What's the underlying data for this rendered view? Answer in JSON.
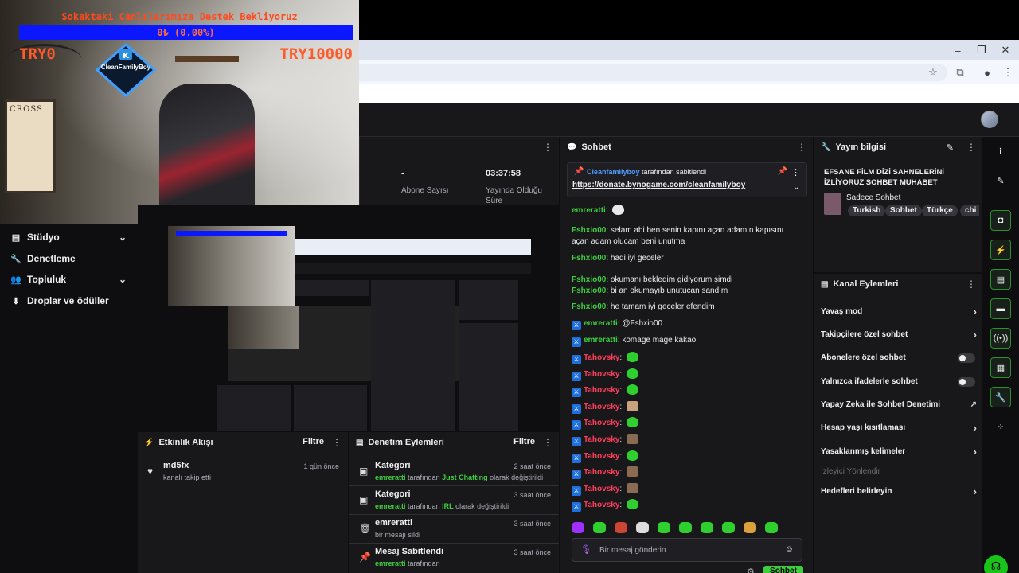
{
  "overlay": {
    "donation_title": "Sokaktaki Canlılarımıza Destek Bekliyoruz",
    "donation_progress": "0₺ (0.00%)",
    "donation_progress_fraction": 0.0,
    "donation_min": "TRY0",
    "donation_max": "TRY10000",
    "logo_text": "CleanFamilyBoy",
    "poster_text": "CROSS"
  },
  "nav": {
    "items": [
      {
        "label": "Stüdyo",
        "icon": "studio-icon",
        "has_chevron": true
      },
      {
        "label": "Denetleme",
        "icon": "wrench-icon",
        "has_chevron": false
      },
      {
        "label": "Topluluk",
        "icon": "community-icon",
        "has_chevron": true
      },
      {
        "label": "Droplar ve ödüller",
        "icon": "drops-icon",
        "has_chevron": false
      }
    ]
  },
  "stats": {
    "subs_value": "-",
    "subs_label": "Abone Sayısı",
    "uptime_value": "03:37:58",
    "uptime_label": "Yayında Olduğu Süre"
  },
  "activity": {
    "title": "Etkinlik Akışı",
    "filter_label": "Filtre",
    "items": [
      {
        "user": "md5fx",
        "desc": "kanalı takip etti",
        "time": "1 gün önce"
      }
    ]
  },
  "modlog": {
    "title": "Denetim Eylemleri",
    "filter_label": "Filtre",
    "items": [
      {
        "title": "Kategori",
        "user": "emreratti",
        "mid": "tarafından",
        "value": "Just Chatting",
        "tail": "olarak değiştirildi",
        "time": "2 saat önce"
      },
      {
        "title": "Kategori",
        "user": "emreratti",
        "mid": "tarafından",
        "value": "IRL",
        "tail": "olarak değiştirildi",
        "time": "3 saat önce"
      },
      {
        "title": "emreratti",
        "user": "",
        "mid": "bir mesajı sildi",
        "value": "",
        "tail": "",
        "time": "3 saat önce"
      },
      {
        "title": "Mesaj Sabitlendi",
        "user": "emreratti",
        "mid": "tarafından",
        "value": "",
        "tail": "",
        "time": "3 saat önce"
      }
    ]
  },
  "chat": {
    "title": "Sohbet",
    "pinned_by": "Cleanfamilyboy",
    "pinned_suffix": "tarafından sabitlendi",
    "pinned_link": "https://donate.bynogame.com/cleanfamilyboy",
    "messages": [
      {
        "user": "emreratti",
        "color": "#3ecf3e",
        "badge": false,
        "text": "",
        "emote": "white"
      },
      {
        "user": "Fshxio00",
        "color": "#3ecf3e",
        "badge": false,
        "text": "selam abi ben senin kapını açan adamın kapısını açan adam olucam beni unutma",
        "emote": ""
      },
      {
        "user": "Fshxio00",
        "color": "#3ecf3e",
        "badge": false,
        "text": "hadi iyi geceler",
        "emote": ""
      },
      {
        "user": "Fshxio00",
        "color": "#3ecf3e",
        "badge": false,
        "text": "okumanı bekledim gidiyorum şimdi",
        "emote": ""
      },
      {
        "user": "Fshxio00",
        "color": "#3ecf3e",
        "badge": false,
        "text": "bi an okumayıb unutucan sandım",
        "emote": ""
      },
      {
        "user": "Fshxio00",
        "color": "#3ecf3e",
        "badge": false,
        "text": "he tamam iyi geceler efendim",
        "emote": ""
      },
      {
        "user": "emreratti",
        "color": "#3ecf3e",
        "badge": true,
        "text": "@Fshxio00",
        "emote": ""
      },
      {
        "user": "emreratti",
        "color": "#3ecf3e",
        "badge": true,
        "text": "komage mage kakao",
        "emote": ""
      },
      {
        "user": "Tahovsky",
        "color": "#ff3e5a",
        "badge": true,
        "text": "",
        "emote": "green"
      },
      {
        "user": "Tahovsky",
        "color": "#ff3e5a",
        "badge": true,
        "text": "",
        "emote": "green"
      },
      {
        "user": "Tahovsky",
        "color": "#ff3e5a",
        "badge": true,
        "text": "",
        "emote": "green"
      },
      {
        "user": "Tahovsky",
        "color": "#ff3e5a",
        "badge": true,
        "text": "",
        "emote": "cat"
      },
      {
        "user": "Tahovsky",
        "color": "#ff3e5a",
        "badge": true,
        "text": "",
        "emote": "green"
      },
      {
        "user": "Tahovsky",
        "color": "#ff3e5a",
        "badge": true,
        "text": "",
        "emote": "brown"
      },
      {
        "user": "Tahovsky",
        "color": "#ff3e5a",
        "badge": true,
        "text": "",
        "emote": "green"
      },
      {
        "user": "Tahovsky",
        "color": "#ff3e5a",
        "badge": true,
        "text": "",
        "emote": "brown"
      },
      {
        "user": "Tahovsky",
        "color": "#ff3e5a",
        "badge": true,
        "text": "",
        "emote": "brown"
      },
      {
        "user": "Tahovsky",
        "color": "#ff3e5a",
        "badge": true,
        "text": "",
        "emote": "green"
      }
    ],
    "input_placeholder": "Bir mesaj gönderin",
    "send_label": "Sohbet"
  },
  "stream_info": {
    "panel_title": "Yayın bilgisi",
    "title": "EFSANE FİLM DİZİ SAHNELERİNİ İZLİYORUZ SOHBET MUHABET",
    "category": "Sadece Sohbet",
    "tags": [
      "Turkish",
      "Sohbet",
      "Türkçe",
      "chi"
    ]
  },
  "channel_actions": {
    "title": "Kanal Eylemleri",
    "items": [
      {
        "label": "Yavaş mod",
        "control": "chevron"
      },
      {
        "label": "Takipçilere özel sohbet",
        "control": "chevron"
      },
      {
        "label": "Abonelere özel sohbet",
        "control": "toggle"
      },
      {
        "label": "Yalnızca ifadelerle sohbet",
        "control": "toggle"
      },
      {
        "label": "Yapay Zeka ile Sohbet Denetimi",
        "control": "external"
      },
      {
        "label": "Hesap yaşı kısıtlaması",
        "control": "chevron"
      },
      {
        "label": "Yasaklanmış kelimeler",
        "control": "chevron"
      },
      {
        "label": "İzleyici Yönlendir",
        "control": "none"
      },
      {
        "label": "Hedefleri belirleyin",
        "control": "chevron"
      }
    ]
  },
  "colors": {
    "accent_green": "#3ecf3e",
    "tahovsky_red": "#ff3e5a",
    "panel_bg": "#18181b",
    "page_bg": "#0e0e10",
    "donation_bar": "#0b18ff"
  }
}
